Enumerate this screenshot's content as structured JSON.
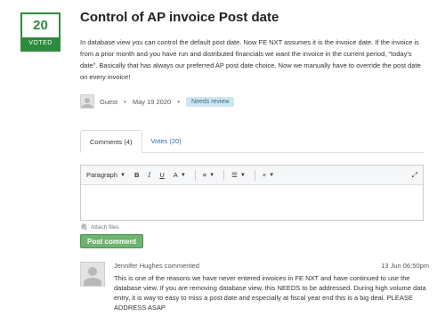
{
  "vote": {
    "count": "20",
    "label": "VOTED"
  },
  "idea": {
    "title": "Control of AP invoice Post date",
    "description": "In database view you can control the default post date. Now FE NXT assumes it is the invoice date. If the invoice is from a prior month and you have run and distributed financials we want the invoice in the current period, \"today's date\". Basically that has always our preferred AP post date choice. Now we manually have to override the post date on every invoice!",
    "author": "Guest",
    "date": "May 19 2020",
    "status": "Needs review"
  },
  "tabs": [
    {
      "label": "Comments (4)"
    },
    {
      "label": "Votes (20)"
    }
  ],
  "toolbar": {
    "paragraph": "Paragraph",
    "bold": "B",
    "italic": "I",
    "underline": "U",
    "text_color": "A",
    "align": "≡",
    "list": "☰",
    "insert": "+",
    "expand": "⤢"
  },
  "attach_label": "Attach files",
  "post_button": "Post comment",
  "comment": {
    "author_line": "Jennifer Hughes commented",
    "date": "13 Jun 06:50pm",
    "text": "This is one of the reasons we have never entered invoices in FE NXT and have continued to use the database view. If you are removing database view, this NEEDS to be addressed. During high volume data entry, it is way to easy to miss a post date and especially at fiscal year end this is a big deal. PLEASE ADDRESS ASAP"
  },
  "colors": {
    "accent_green": "#2e8b3d",
    "button_green": "#6fb36f",
    "link_blue": "#2a6fb0",
    "badge_bg": "#cfe7f0"
  }
}
